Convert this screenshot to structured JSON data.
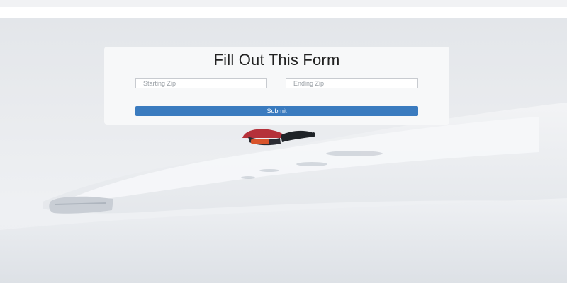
{
  "form": {
    "title": "Fill Out This Form",
    "starting_zip_placeholder": "Starting Zip",
    "ending_zip_placeholder": "Ending Zip",
    "submit_label": "Submit"
  },
  "colors": {
    "submit_button": "#3a7bbf",
    "card_background": "#f7f8f9",
    "top_bar": "#f1f2f4"
  }
}
